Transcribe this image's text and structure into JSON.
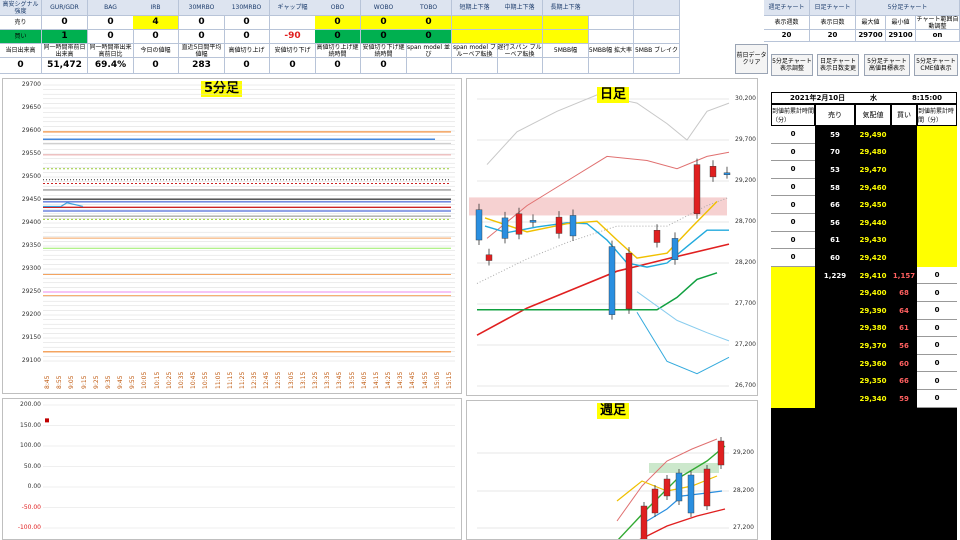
{
  "header": {
    "row1": [
      {
        "label": "高安シグナル強度",
        "v1": "売り",
        "v2": "買い",
        "mid": "当日出来高",
        "vmid": "0"
      },
      {
        "label": "GUR/GDR",
        "v1": "0",
        "v2": "1",
        "mid": "同一時間帯前日出来高",
        "vmid": "51,472"
      },
      {
        "label": "BAG",
        "v1": "0",
        "v2": "0",
        "mid": "同一時間帯出来高前日比",
        "vmid": "69.4%"
      },
      {
        "label": "IRB",
        "v1": "4",
        "v2": "0",
        "mid": "今日の値幅",
        "vmid": "0"
      },
      {
        "label": "30MRBO",
        "v1": "0",
        "v2": "0",
        "mid": "直近5日間平均値幅",
        "vmid": "283"
      },
      {
        "label": "130MRBO",
        "v1": "0",
        "v2": "0",
        "mid": "高値切り上げ",
        "vmid": "0"
      },
      {
        "label": "ギャップ幅",
        "v1": "",
        "v2": "-90",
        "mid": "安値切り下げ",
        "vmid": "0"
      },
      {
        "label": "OBO",
        "v1": "0",
        "v2": "0",
        "mid": "高値切り上げ継続時間",
        "vmid": "0"
      },
      {
        "label": "WOBO",
        "v1": "0",
        "v2": "0",
        "mid": "安値切り下げ継続時間",
        "vmid": "0"
      },
      {
        "label": "TOBO",
        "v1": "0",
        "v2": "0",
        "mid": "span model 並び",
        "vmid": ""
      },
      {
        "label": "短期上下落",
        "v1": "",
        "v2": "",
        "mid": "span model ブルーベア転換",
        "vmid": ""
      },
      {
        "label": "中期上下落",
        "v1": "",
        "v2": "",
        "mid": "遅行スパン ブルーベア転換",
        "vmid": ""
      },
      {
        "label": "長期上下落",
        "v1": "",
        "v2": "",
        "mid": "5MBB幅",
        "vmid": ""
      },
      {
        "label": "",
        "v1": "",
        "v2": "",
        "mid": "5MBB幅 拡大率",
        "vmid": ""
      },
      {
        "label": "",
        "v1": "",
        "v2": "",
        "mid": "5MBB ブレイク",
        "vmid": ""
      }
    ],
    "right_top": {
      "weekly_chart": "週足チャート",
      "daily_chart": "日足チャート",
      "min5_chart": "5分足チャート",
      "display_weeks": "表示週数",
      "display_days": "表示日数",
      "max_price": "最大値",
      "min_price": "最小値",
      "range_auto": "チャート範囲自動調整",
      "weeks_val": "20",
      "days_val": "20",
      "max_val": "29700",
      "min_val": "29100",
      "auto_val": "on"
    },
    "buttons": {
      "clear_daily": "前日データクリア",
      "adj_5min": "5分足チャート表示調整",
      "change_daily": "日足チャート表示日数変更",
      "high_low_5min": "5分足チャート高値目標表示",
      "cme_5min": "5分足チャートCME値表示"
    }
  },
  "min5_chart": {
    "title": "5分足",
    "yticks": [
      "29700",
      "29650",
      "29600",
      "29550",
      "29500",
      "29450",
      "29400",
      "29350",
      "29300",
      "29250",
      "29200",
      "29150",
      "29100"
    ],
    "xticks": [
      "8:45",
      "8:55",
      "9:05",
      "9:15",
      "9:25",
      "9:35",
      "9:45",
      "9:55",
      "10:05",
      "10:15",
      "10:25",
      "10:35",
      "10:45",
      "10:55",
      "11:05",
      "11:15",
      "11:25",
      "12:35",
      "12:45",
      "12:55",
      "13:05",
      "13:15",
      "13:25",
      "13:35",
      "13:45",
      "13:55",
      "14:05",
      "14:15",
      "14:25",
      "14:35",
      "14:45",
      "14:55",
      "15:05",
      "15:15"
    ]
  },
  "osc_chart": {
    "yticks": [
      "200.00",
      "150.00",
      "100.00",
      "50.00",
      "0.00",
      "-50.00",
      "-100.00"
    ]
  },
  "daily_chart": {
    "title": "日足",
    "yticks": [
      "30,200",
      "29,700",
      "29,200",
      "28,700",
      "28,200",
      "27,700",
      "27,200",
      "26,700"
    ]
  },
  "weekly_chart": {
    "title": "週足",
    "yticks": [
      "29,200",
      "28,200",
      "27,200"
    ]
  },
  "orderbook": {
    "date": "2021年2月10日",
    "weekday": "水",
    "time": "8:15:00",
    "col_cancel_sell": "到値前累計時間（分）",
    "col_sell": "売り",
    "col_price": "気配値",
    "col_buy": "買い",
    "col_cancel_buy": "到値前累計時間（分）",
    "rows": [
      {
        "c1": "0",
        "sell": "59",
        "price": "29,490",
        "buy": "",
        "c2": ""
      },
      {
        "c1": "0",
        "sell": "70",
        "price": "29,480",
        "buy": "",
        "c2": ""
      },
      {
        "c1": "0",
        "sell": "53",
        "price": "29,470",
        "buy": "",
        "c2": ""
      },
      {
        "c1": "0",
        "sell": "58",
        "price": "29,460",
        "buy": "",
        "c2": ""
      },
      {
        "c1": "0",
        "sell": "66",
        "price": "29,450",
        "buy": "",
        "c2": ""
      },
      {
        "c1": "0",
        "sell": "56",
        "price": "29,440",
        "buy": "",
        "c2": ""
      },
      {
        "c1": "0",
        "sell": "61",
        "price": "29,430",
        "buy": "",
        "c2": ""
      },
      {
        "c1": "0",
        "sell": "60",
        "price": "29,420",
        "buy": "",
        "c2": ""
      },
      {
        "c1": "",
        "sell": "1,229",
        "price": "29,410",
        "buy": "1,157",
        "c2": "0"
      },
      {
        "c1": "",
        "sell": "",
        "price": "29,400",
        "buy": "68",
        "c2": "0"
      },
      {
        "c1": "",
        "sell": "",
        "price": "29,390",
        "buy": "64",
        "c2": "0"
      },
      {
        "c1": "",
        "sell": "",
        "price": "29,380",
        "buy": "61",
        "c2": "0"
      },
      {
        "c1": "",
        "sell": "",
        "price": "29,370",
        "buy": "56",
        "c2": "0"
      },
      {
        "c1": "",
        "sell": "",
        "price": "29,360",
        "buy": "60",
        "c2": "0"
      },
      {
        "c1": "",
        "sell": "",
        "price": "29,350",
        "buy": "66",
        "c2": "0"
      },
      {
        "c1": "",
        "sell": "",
        "price": "29,340",
        "buy": "59",
        "c2": "0"
      }
    ]
  },
  "colors": {
    "green": "#00b050",
    "yellow": "#ffff00",
    "red": "#e02020",
    "blue": "#1f77d0"
  }
}
